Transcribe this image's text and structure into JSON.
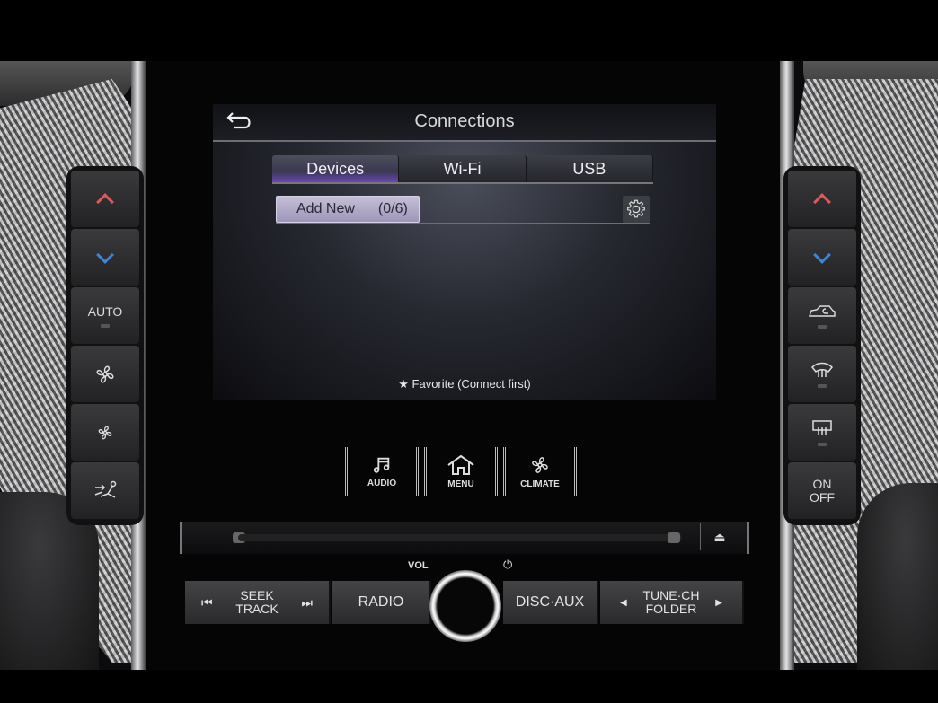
{
  "screen": {
    "title": "Connections",
    "back_icon": "back-arrow-icon",
    "tabs": [
      {
        "label": "Devices",
        "active": true
      },
      {
        "label": "Wi-Fi",
        "active": false
      },
      {
        "label": "USB",
        "active": false
      }
    ],
    "add_new": {
      "label": "Add New",
      "count": "(0/6)"
    },
    "settings_icon": "gear-icon",
    "favorite_note": "Favorite (Connect first)",
    "accent_color": "#6b45b8"
  },
  "hard_keys": [
    {
      "label": "AUDIO",
      "icon": "music-note-icon"
    },
    {
      "label": "MENU",
      "icon": "home-icon"
    },
    {
      "label": "CLIMATE",
      "icon": "fan-icon"
    }
  ],
  "left_climate": {
    "auto_label": "AUTO"
  },
  "right_climate": {
    "on_label": "ON",
    "off_label": "OFF"
  },
  "disc": {
    "eject_symbol": "⏏"
  },
  "controls": {
    "vol_label": "VOL",
    "power_symbol": "⏻",
    "seek_line1": "SEEK",
    "seek_line2": "TRACK",
    "radio": "RADIO",
    "disc_aux": "DISC·AUX",
    "tune_line1": "TUNE·CH",
    "tune_line2": "FOLDER",
    "prev_symbol": "⏮",
    "next_symbol": "⏭",
    "left_symbol": "◀",
    "right_symbol": "▶"
  }
}
